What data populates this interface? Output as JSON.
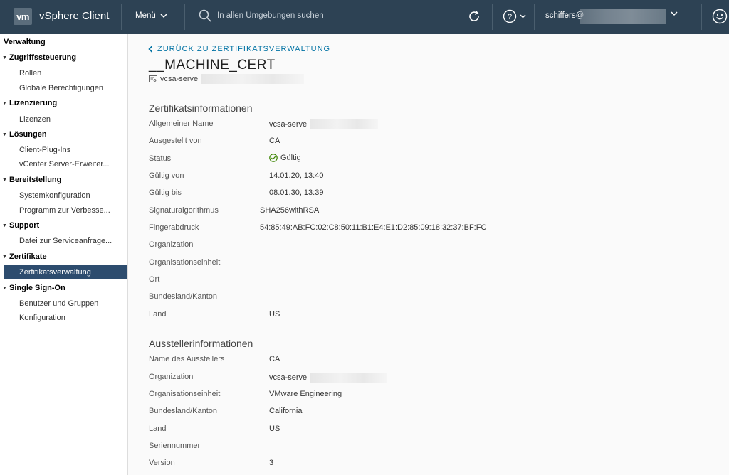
{
  "header": {
    "logo": "vm",
    "app_title": "vSphere Client",
    "menu_label": "Menü",
    "search_placeholder": "In allen Umgebungen suchen",
    "user": "schiffers@"
  },
  "sidebar": {
    "title": "Verwaltung",
    "groups": [
      {
        "label": "Zugriffssteuerung",
        "items": [
          "Rollen",
          "Globale Berechtigungen"
        ]
      },
      {
        "label": "Lizenzierung",
        "items": [
          "Lizenzen"
        ]
      },
      {
        "label": "Lösungen",
        "items": [
          "Client-Plug-Ins",
          "vCenter Server-Erweiter..."
        ]
      },
      {
        "label": "Bereitstellung",
        "items": [
          "Systemkonfiguration",
          "Programm zur Verbesse..."
        ]
      },
      {
        "label": "Support",
        "items": [
          "Datei zur Serviceanfrage..."
        ]
      },
      {
        "label": "Zertifikate",
        "items": [
          "Zertifikatsverwaltung"
        ]
      },
      {
        "label": "Single Sign-On",
        "items": [
          "Benutzer und Gruppen",
          "Konfiguration"
        ]
      }
    ]
  },
  "main": {
    "back_link": "ZURÜCK ZU ZERTIFIKATSVERWALTUNG",
    "title": "__MACHINE_CERT",
    "subtitle": "vcsa-serve",
    "cert_info": {
      "heading": "Zertifikatsinformationen",
      "rows": [
        {
          "label": "Allgemeiner Name",
          "value": "vcsa-serve"
        },
        {
          "label": "Ausgestellt von",
          "value": "CA"
        },
        {
          "label": "Status",
          "value": "Gültig"
        },
        {
          "label": "Gültig von",
          "value": "14.01.20, 13:40"
        },
        {
          "label": "Gültig bis",
          "value": "08.01.30, 13:39"
        },
        {
          "label": "Signaturalgorithmus",
          "value": "SHA256withRSA"
        },
        {
          "label": "Fingerabdruck",
          "value": "54:85:49:AB:FC:02:C8:50:11:B1:E4:E1:D2:85:09:18:32:37:BF:FC"
        },
        {
          "label": "Organization",
          "value": ""
        },
        {
          "label": "Organisationseinheit",
          "value": ""
        },
        {
          "label": "Ort",
          "value": ""
        },
        {
          "label": "Bundesland/Kanton",
          "value": ""
        },
        {
          "label": "Land",
          "value": "US"
        }
      ]
    },
    "issuer_info": {
      "heading": "Ausstellerinformationen",
      "rows": [
        {
          "label": "Name des Ausstellers",
          "value": "CA"
        },
        {
          "label": "Organization",
          "value": "vcsa-serve"
        },
        {
          "label": "Organisationseinheit",
          "value": "VMware Engineering"
        },
        {
          "label": "Bundesland/Kanton",
          "value": "California"
        },
        {
          "label": "Land",
          "value": "US"
        },
        {
          "label": "Seriennummer",
          "value": ""
        },
        {
          "label": "Version",
          "value": "3"
        }
      ]
    }
  },
  "colors": {
    "header_bg": "#2d4254",
    "active_item_bg": "#2d4c6e",
    "link": "#0072a3",
    "valid_green": "#3c8500"
  }
}
